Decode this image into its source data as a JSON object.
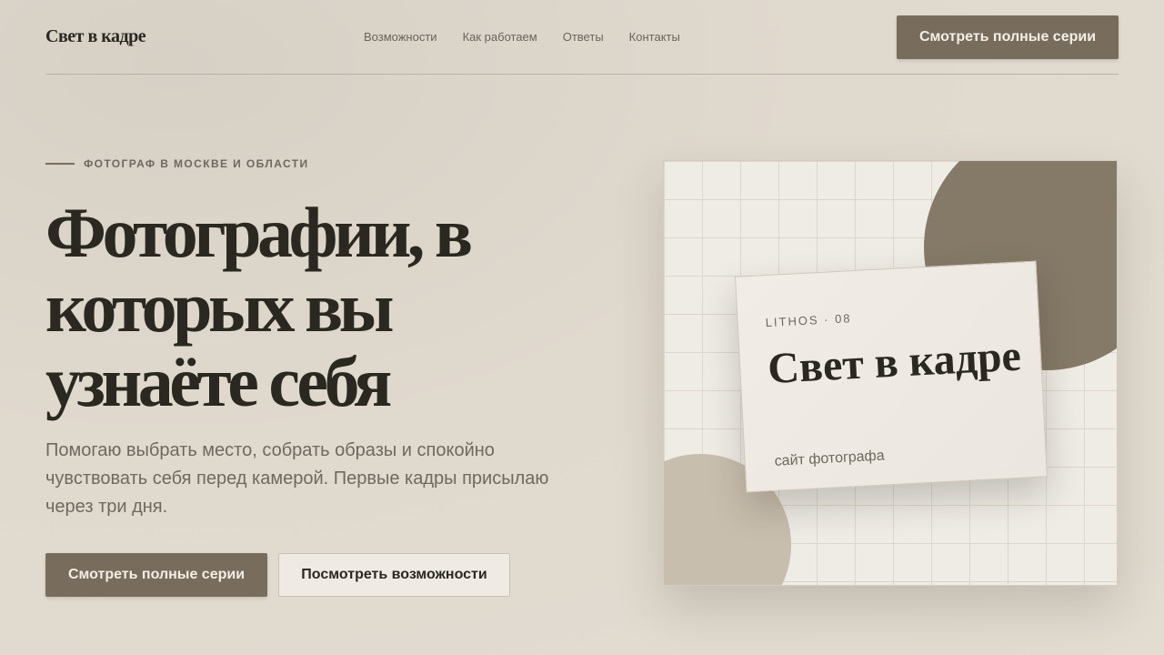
{
  "header": {
    "logo": "Свет в кадре",
    "nav": [
      "Возможности",
      "Как работаем",
      "Ответы",
      "Контакты"
    ],
    "cta_label": "Смотреть полные серии"
  },
  "hero": {
    "eyebrow": "ФОТОГРАФ В МОСКВЕ И ОБЛАСТИ",
    "title": "Фотографии, в которых вы узнаёте себя",
    "description": "Помогаю выбрать место, собрать образы и спокойно чувствовать себя перед камерой. Первые кадры присылаю через три дня.",
    "primary_button": "Смотреть полные серии",
    "secondary_button": "Посмотреть возможности"
  },
  "card": {
    "meta": "LITHOS · 08",
    "title": "Свет в кадре",
    "subtitle": "сайт фотографа"
  },
  "colors": {
    "accent": "#786d5c",
    "text_dark": "#2a2821",
    "text_muted": "#6e685e",
    "background": "#e0d9ce"
  }
}
